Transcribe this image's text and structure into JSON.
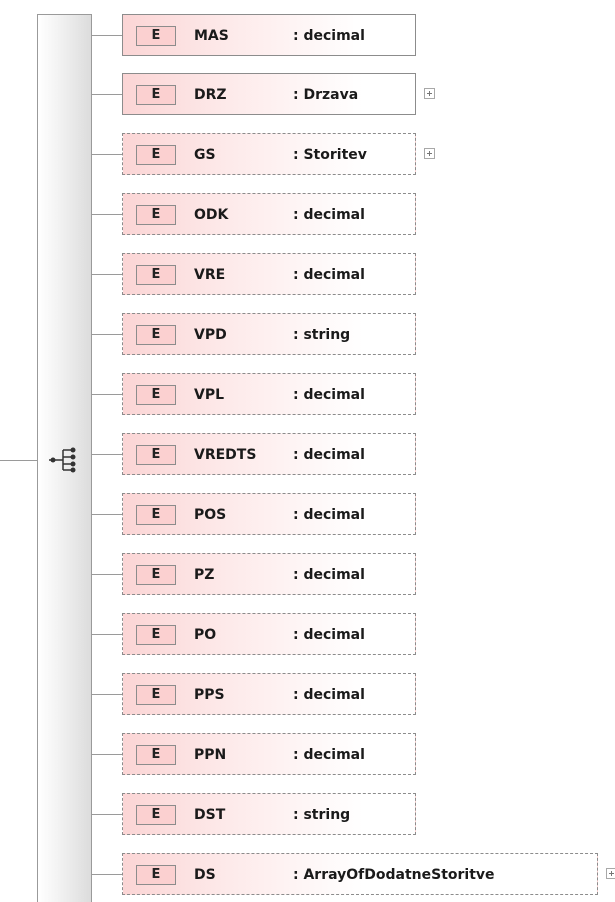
{
  "schema": {
    "badge_label": "E",
    "elements": [
      {
        "name": "MAS",
        "type": ": decimal",
        "required": true,
        "expandable": false
      },
      {
        "name": "DRZ",
        "type": ": Drzava",
        "required": true,
        "expandable": true
      },
      {
        "name": "GS",
        "type": ": Storitev",
        "required": false,
        "expandable": true
      },
      {
        "name": "ODK",
        "type": ": decimal",
        "required": false,
        "expandable": false
      },
      {
        "name": "VRE",
        "type": ": decimal",
        "required": false,
        "expandable": false
      },
      {
        "name": "VPD",
        "type": ": string",
        "required": false,
        "expandable": false
      },
      {
        "name": "VPL",
        "type": ": decimal",
        "required": false,
        "expandable": false
      },
      {
        "name": "VREDTS",
        "type": ": decimal",
        "required": false,
        "expandable": false
      },
      {
        "name": "POS",
        "type": ": decimal",
        "required": false,
        "expandable": false
      },
      {
        "name": "PZ",
        "type": ": decimal",
        "required": false,
        "expandable": false
      },
      {
        "name": "PO",
        "type": ": decimal",
        "required": false,
        "expandable": false
      },
      {
        "name": "PPS",
        "type": ": decimal",
        "required": false,
        "expandable": false
      },
      {
        "name": "PPN",
        "type": ": decimal",
        "required": false,
        "expandable": false
      },
      {
        "name": "DST",
        "type": ": string",
        "required": false,
        "expandable": false
      },
      {
        "name": "DS",
        "type": ": ArrayOfDodatneStoritve",
        "required": false,
        "expandable": true
      }
    ],
    "colors": {
      "element_fill": "#fde9e9",
      "badge_fill": "#fbd0d0",
      "border": "#8c8c8c"
    },
    "icons": {
      "sequence": "sequence-compositor-icon",
      "expand": "plus-expand-icon"
    }
  }
}
